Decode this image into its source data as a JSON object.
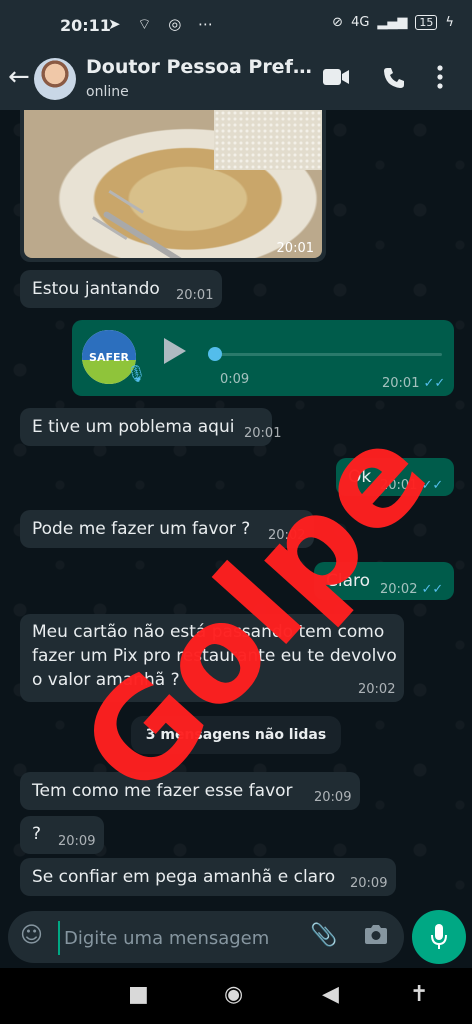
{
  "status_bar": {
    "time": "20:11",
    "left_icons": "➤ ⌔ ◎ ⋯",
    "network": "4G",
    "battery": "15"
  },
  "header": {
    "contact_name": "Doutor Pessoa Prefei...",
    "presence": "online",
    "back_icon": "arrow-left",
    "video_icon": "video-camera",
    "call_icon": "phone",
    "menu_icon": "more-vertical"
  },
  "messages": [
    {
      "type": "image",
      "time": "20:01"
    },
    {
      "type": "text",
      "dir": "in",
      "text": "Estou jantando",
      "time": "20:01"
    },
    {
      "type": "audio",
      "dir": "out",
      "logo_text": "SAFER",
      "duration": "0:09",
      "time": "20:01",
      "ticks": "✓✓"
    },
    {
      "type": "text",
      "dir": "in",
      "text": "E tive um poblema aqui",
      "time": "20:01"
    },
    {
      "type": "text",
      "dir": "out",
      "text": "Ok",
      "time": "20:01",
      "ticks": "✓✓"
    },
    {
      "type": "text",
      "dir": "in",
      "text": "Pode me fazer um favor ?",
      "time": "20:02"
    },
    {
      "type": "text",
      "dir": "out",
      "text": "Claro",
      "time": "20:02",
      "ticks": "✓✓"
    },
    {
      "type": "text",
      "dir": "in",
      "text": "Meu cartão não está passando tem como fazer um Pix pro restaurante eu te devolvo o valor amanhã ?",
      "time": "20:02"
    },
    {
      "type": "text",
      "dir": "in",
      "text": "Tem como me fazer esse favor",
      "time": "20:09"
    },
    {
      "type": "text",
      "dir": "in",
      "text": "?",
      "time": "20:09"
    },
    {
      "type": "text",
      "dir": "in",
      "text": "Se confiar em pega amanhã e claro",
      "time": "20:09"
    }
  ],
  "unread_divider": "3 mensagens não lidas",
  "watermark": "Golpe",
  "composer": {
    "placeholder": "Digite uma mensagem"
  },
  "colors": {
    "incoming": "#202c33",
    "outgoing": "#005c4b",
    "accent": "#00a884",
    "ticks": "#53bdeb",
    "watermark": "#ff2020"
  }
}
